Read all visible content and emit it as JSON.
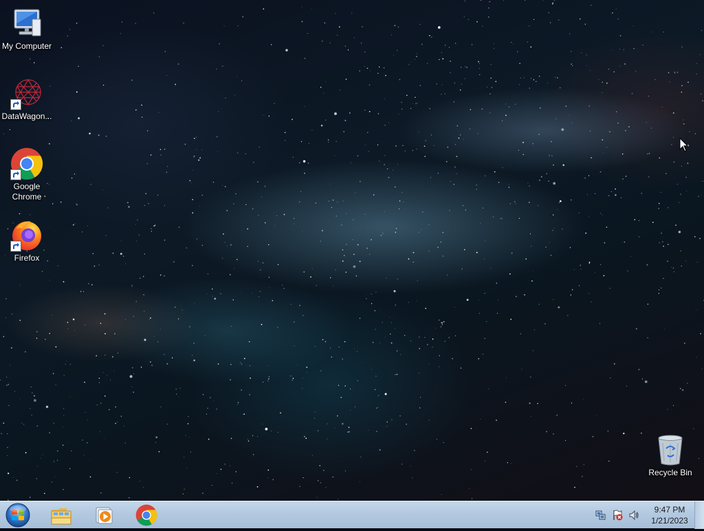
{
  "desktop": {
    "icons": [
      {
        "label": "My Computer",
        "icon": "computer-icon"
      },
      {
        "label": "DataWagon...",
        "icon": "datawagon-icon"
      },
      {
        "label": "Google Chrome",
        "icon": "chrome-icon"
      },
      {
        "label": "Firefox",
        "icon": "firefox-icon"
      },
      {
        "label": "Recycle Bin",
        "icon": "recycle-bin-icon"
      }
    ]
  },
  "taskbar": {
    "start_icon": "windows-start-icon",
    "pinned": [
      {
        "icon": "file-explorer-icon"
      },
      {
        "icon": "media-player-icon"
      },
      {
        "icon": "chrome-icon"
      }
    ],
    "tray": {
      "icons": [
        "network-icon",
        "action-center-flag-icon",
        "speaker-icon"
      ],
      "time": "9:47 PM",
      "date": "1/21/2023"
    }
  },
  "colors": {
    "taskbar": "#b3c9e0",
    "chrome_red": "#db4437",
    "chrome_yellow": "#f4c20d",
    "chrome_green": "#0f9d58",
    "chrome_blue": "#4285f4"
  }
}
